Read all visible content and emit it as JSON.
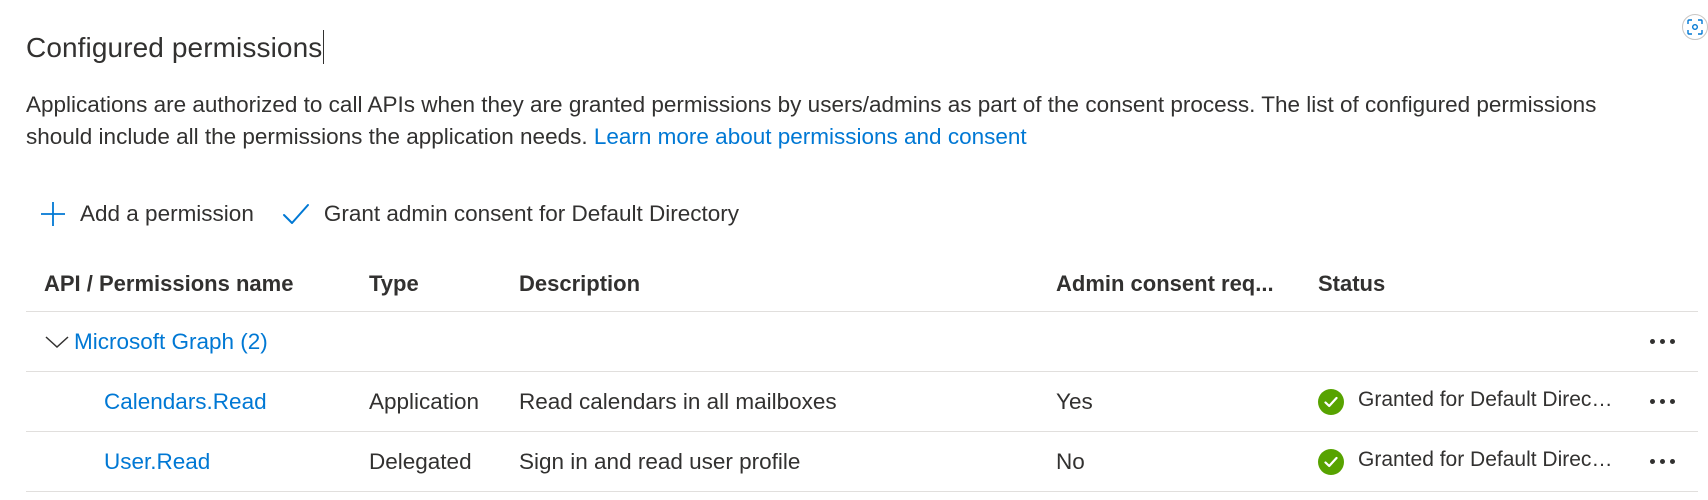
{
  "page": {
    "title": "Configured permissions",
    "description": "Applications are authorized to call APIs when they are granted permissions by users/admins as part of the consent process. The list of configured permissions should include all the permissions the application needs.",
    "learn_more_link": "Learn more about permissions and consent"
  },
  "toolbar": {
    "add_permission_label": "Add a permission",
    "grant_consent_label": "Grant admin consent for Default Directory",
    "accent_color": "#0078d4"
  },
  "table": {
    "columns": {
      "name": "API / Permissions name",
      "type": "Type",
      "description": "Description",
      "admin_consent": "Admin consent req...",
      "status": "Status"
    },
    "group": {
      "label": "Microsoft Graph (2)",
      "expanded": true
    },
    "rows": [
      {
        "name": "Calendars.Read",
        "type": "Application",
        "description": "Read calendars in all mailboxes",
        "admin_consent": "Yes",
        "status": "Granted for Default Directory",
        "status_color": "#57a300"
      },
      {
        "name": "User.Read",
        "type": "Delegated",
        "description": "Sign in and read user profile",
        "admin_consent": "No",
        "status": "Granted for Default Directory",
        "status_color": "#57a300"
      }
    ]
  },
  "icons": {
    "add": "plus-icon",
    "grant": "checkmark-icon",
    "group_toggle": "chevron-down-icon",
    "status": "check-circle-icon",
    "more": "more-ellipsis-icon",
    "corner": "screenshot-capture-icon"
  }
}
